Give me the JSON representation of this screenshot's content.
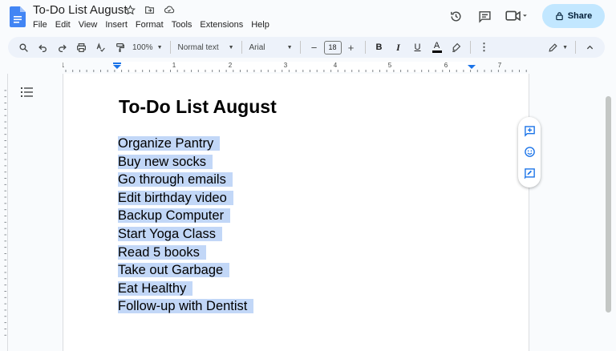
{
  "app": {
    "doc_title": "To-Do List August",
    "menu": [
      "File",
      "Edit",
      "View",
      "Insert",
      "Format",
      "Tools",
      "Extensions",
      "Help"
    ],
    "share_label": "Share",
    "icons": {
      "logo": "docs-logo-icon",
      "star": "star-icon",
      "move": "folder-move-icon",
      "cloud": "cloud-saved-icon",
      "history": "history-icon",
      "comments": "comment-icon",
      "meet": "video-call-icon",
      "lock": "lock-icon"
    }
  },
  "toolbar": {
    "zoom": "100%",
    "style": "Normal text",
    "font": "Arial",
    "font_size": "18",
    "bold": "B",
    "italic": "I",
    "underline": "U",
    "text_color": "A"
  },
  "ruler": {
    "numbers": [
      "1",
      "1",
      "2",
      "3",
      "4",
      "5",
      "6",
      "7"
    ]
  },
  "document": {
    "title": "To-Do List August",
    "items": [
      "Organize Pantry",
      "Buy new socks",
      "Go through emails",
      "Edit birthday video",
      "Backup Computer",
      "Start Yoga Class",
      "Read 5 books",
      "Take out Garbage",
      "Eat Healthy",
      "Follow-up with Dentist"
    ]
  },
  "colors": {
    "selection": "#c2d7f7",
    "share_bg": "#c2e7ff",
    "toolbar_bg": "#edf2fa",
    "accent": "#1a73e8"
  }
}
